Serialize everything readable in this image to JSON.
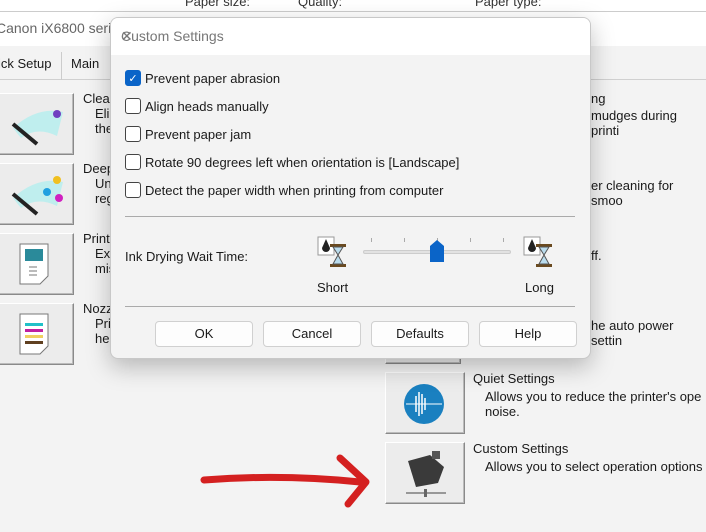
{
  "background": {
    "top_labels": [
      "Paper size:",
      "Quality:",
      "Paper type:"
    ],
    "window_title": "Canon iX6800 seri",
    "tabs": [
      "ick Setup",
      "Main"
    ],
    "left_items": [
      {
        "title": "Clea",
        "desc": [
          "Eli",
          "the"
        ],
        "icon": "cleaning-icon"
      },
      {
        "title": "Deep",
        "desc": [
          "Un",
          "reg"
        ],
        "icon": "deep-cleaning-icon"
      },
      {
        "title": "Print",
        "desc": [
          "Ex",
          "mis"
        ],
        "icon": "print-head-alignment-icon"
      },
      {
        "title": "Nozz",
        "desc": [
          "Pri",
          "he"
        ],
        "icon": "nozzle-check-icon"
      }
    ],
    "right_fragments": [
      "ng",
      "mudges during printi",
      "er cleaning for smoo",
      "ff.",
      "he auto power settin"
    ],
    "right_items": [
      {
        "title": "Quiet Settings",
        "desc": [
          "Allows you to reduce the printer's ope",
          "noise."
        ],
        "icon": "quiet-settings-icon"
      },
      {
        "title": "Custom Settings",
        "desc": [
          "Allows you to select operation options"
        ],
        "icon": "custom-settings-icon"
      }
    ]
  },
  "dialog": {
    "title": "Custom Settings",
    "options": [
      {
        "label": "Prevent paper abrasion",
        "checked": true
      },
      {
        "label": "Align heads manually",
        "checked": false
      },
      {
        "label": "Prevent paper jam",
        "checked": false
      },
      {
        "label": "Rotate 90 degrees left when orientation is [Landscape]",
        "checked": false
      },
      {
        "label": "Detect the paper width when printing from computer",
        "checked": false
      }
    ],
    "ink_drying": {
      "label": "Ink Drying Wait Time:",
      "min_label": "Short",
      "max_label": "Long",
      "position": 3,
      "steps": 5
    },
    "buttons": {
      "ok": "OK",
      "cancel": "Cancel",
      "defaults": "Defaults",
      "help": "Help"
    },
    "accent": "#0a64c8"
  },
  "annotation": {
    "arrow_color": "#d42020"
  }
}
